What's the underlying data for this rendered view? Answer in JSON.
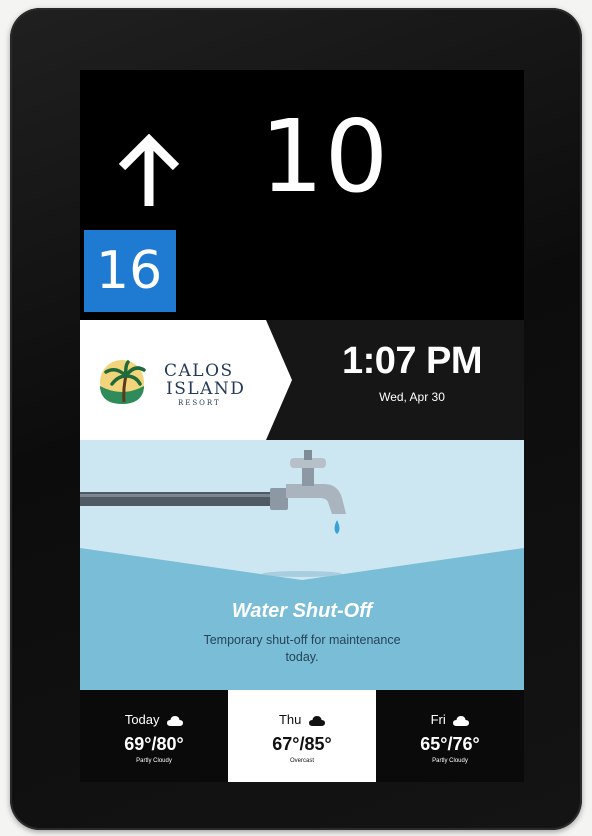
{
  "elevator": {
    "direction": "up",
    "current_floor": "10",
    "destination_floor": "16"
  },
  "header": {
    "brand_line1": "CALOS",
    "brand_line2": "ISLAND",
    "brand_line3": "RESORT",
    "time": "1:07 PM",
    "date": "Wed, Apr 30"
  },
  "notice": {
    "title": "Water Shut-Off",
    "body": "Temporary shut-off for maintenance today."
  },
  "weather": {
    "days": [
      {
        "label": "Today",
        "temp": "69°/80°",
        "condition": "Partly Cloudy",
        "icon": "cloud-icon",
        "selected": false
      },
      {
        "label": "Thu",
        "temp": "67°/85°",
        "condition": "Overcast",
        "icon": "cloud-icon",
        "selected": true
      },
      {
        "label": "Fri",
        "temp": "65°/76°",
        "condition": "Partly Cloudy",
        "icon": "cloud-icon",
        "selected": false
      }
    ]
  },
  "colors": {
    "destination_badge": "#1f7ad1",
    "notice_background": "#b9dbea",
    "brand_text": "#243a57"
  }
}
